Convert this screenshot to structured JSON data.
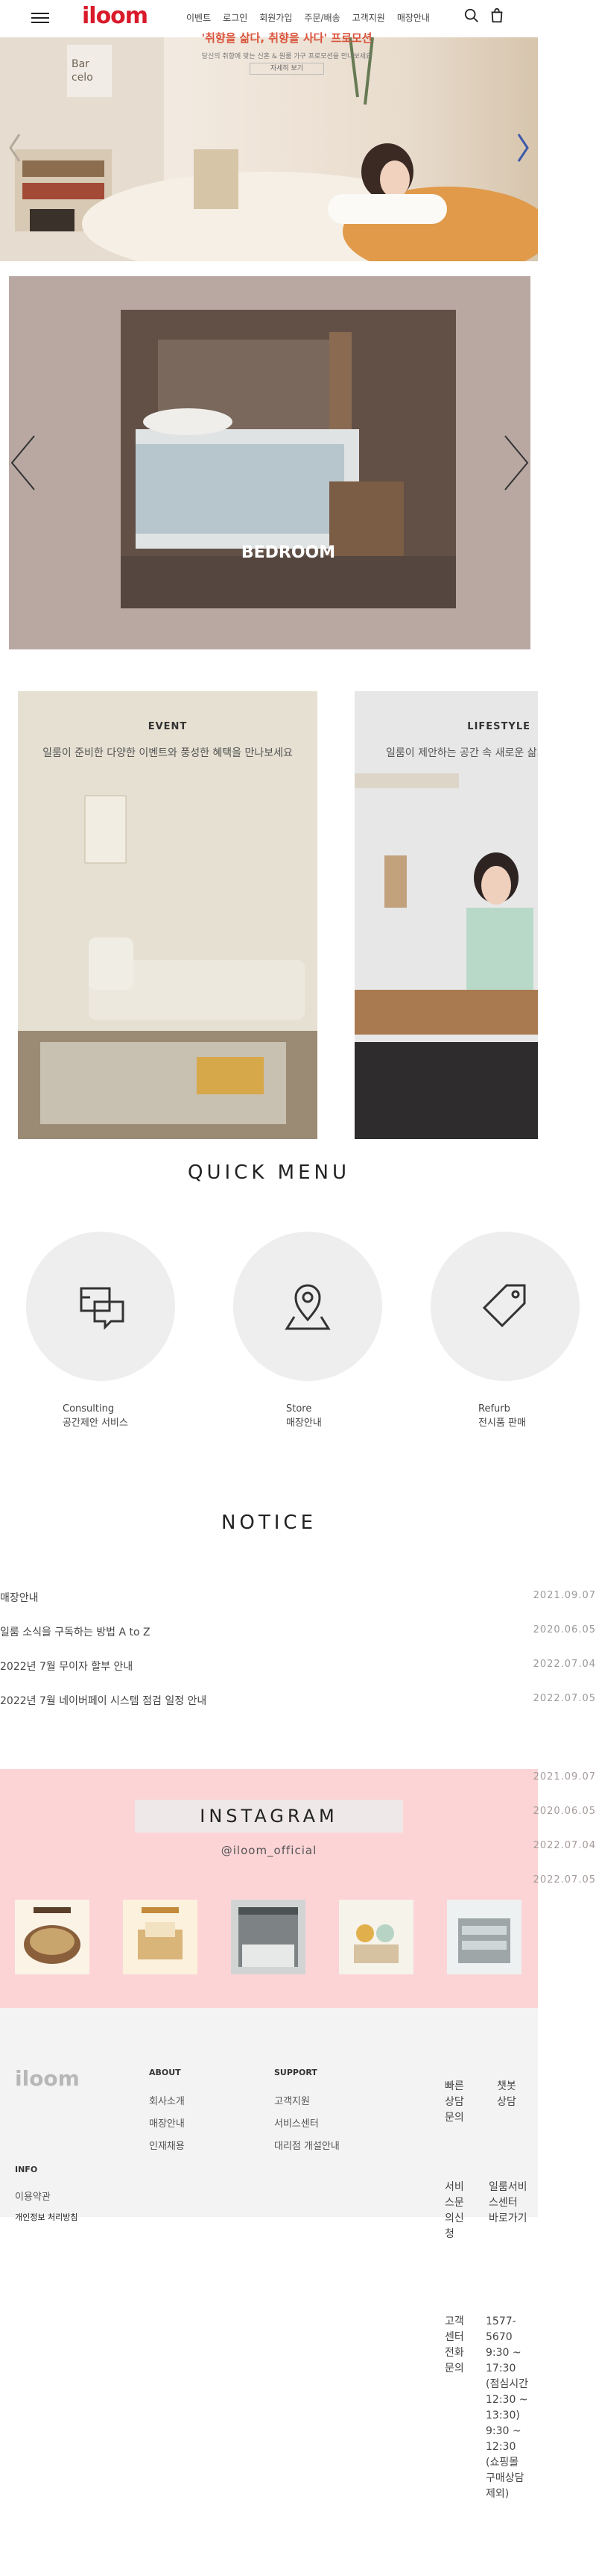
{
  "header": {
    "logo": "iloom",
    "nav": [
      "이벤트",
      "로그인",
      "회원가입",
      "주문/배송",
      "고객지원",
      "매장안내"
    ]
  },
  "hero": {
    "promo_title": "'취향을 삶다, 취향을 사다' 프로모션",
    "promo_sub": "당신의 취향에 맞는 신혼 & 원룸 가구 프로모션을 만나보세요",
    "promo_btn": "자세히 보기"
  },
  "carousel": {
    "title": "BEDROOM"
  },
  "cards": [
    {
      "title": "EVENT",
      "subtitle": "일룸이 준비한 다양한 이벤트와 풍성한 혜택을 만나보세요"
    },
    {
      "title": "LIFESTYLE",
      "subtitle": "일룸이 제안하는 공간 속 새로운 삶의"
    }
  ],
  "quick_menu": {
    "title": "QUICK MENU",
    "items": [
      {
        "en": "Consulting",
        "ko": "공간제안 서비스"
      },
      {
        "en": "Store",
        "ko": "매장안내"
      },
      {
        "en": "Refurb",
        "ko": "전시품 판매"
      }
    ]
  },
  "notice": {
    "title": "NOTICE",
    "items": [
      {
        "text": "매장안내",
        "date": "2021.09.07"
      },
      {
        "text": "일룸 소식을 구독하는 방법 A to Z",
        "date": "2020.06.05"
      },
      {
        "text": "2022년 7월 무이자 할부 안내",
        "date": "2022.07.04"
      },
      {
        "text": "2022년 7월 네이버페이 시스템 점검 일정 안내",
        "date": "2022.07.05"
      }
    ],
    "dates_repeat": [
      "2021.09.07",
      "2020.06.05",
      "2022.07.04",
      "2022.07.05"
    ]
  },
  "instagram": {
    "title": "INSTAGRAM",
    "handle": "@iloom_official"
  },
  "footer": {
    "logo": "iloom",
    "about": {
      "title": "ABOUT",
      "links": [
        "회사소개",
        "매장안내",
        "인재채용"
      ]
    },
    "support": {
      "title": "SUPPORT",
      "links": [
        "고객지원",
        "서비스센터",
        "대리점 개설안내"
      ]
    },
    "info": {
      "title": "INFO",
      "links": [
        "이용약관",
        "개인정보 처리방침"
      ]
    },
    "quick_consult": "빠른상담문의",
    "chatbot": "챗봇상담",
    "service_request": "서비스문의신청",
    "service_center": "일룸서비스센터 바로가기",
    "call_center": "고객센터전화문의",
    "phone": "1577-5670 9:30 ~ 17:30 (점심시간 12:30 ~ 13:30) 9:30 ~ 12:30 (쇼핑몰 구매상담 제외)"
  },
  "colors": {
    "brand": "#d91a2a",
    "insta_bg": "#fcd4d6",
    "carousel_bg": "#b9a8a2"
  }
}
